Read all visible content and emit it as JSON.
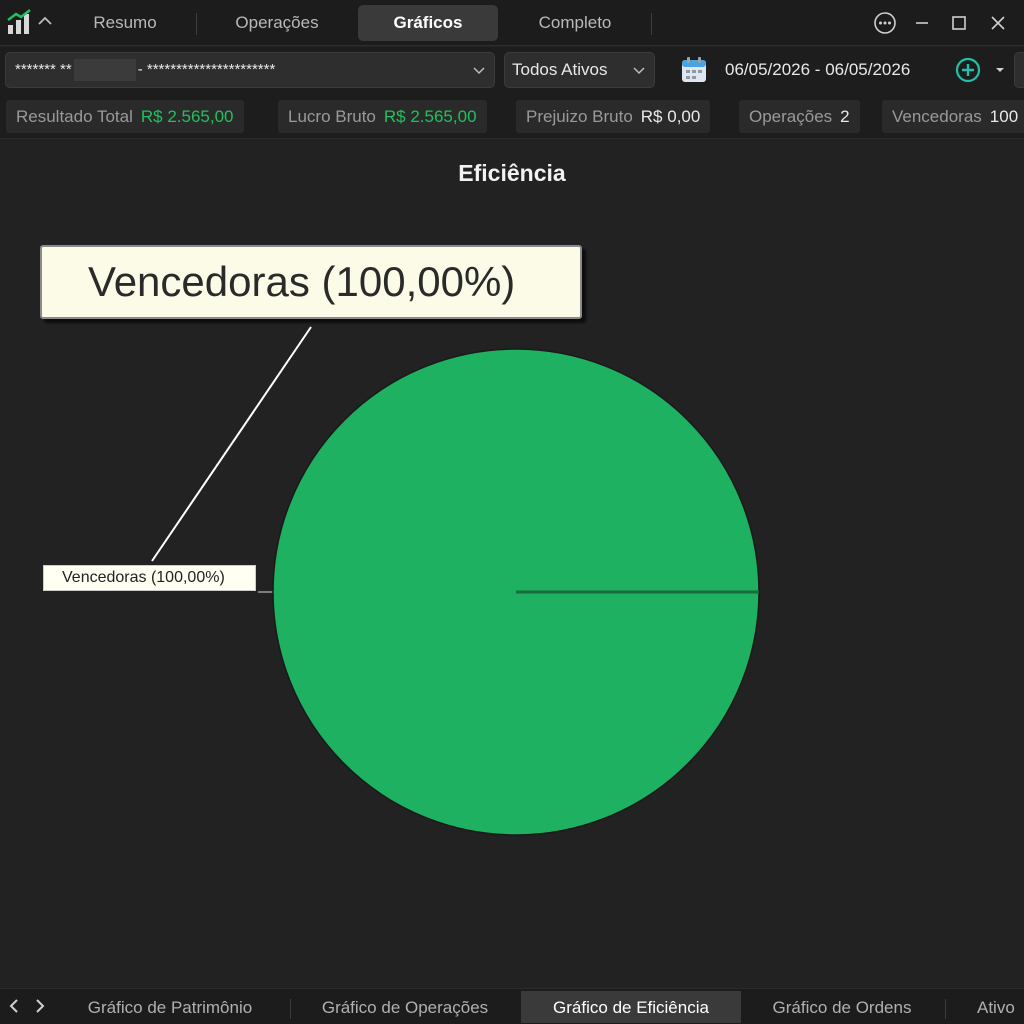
{
  "top_tabs": [
    {
      "label": "Resumo",
      "active": false
    },
    {
      "label": "Operações",
      "active": false
    },
    {
      "label": "Gráficos",
      "active": true
    },
    {
      "label": "Completo",
      "active": false
    }
  ],
  "window_controls": [
    "more-icon",
    "minimize-icon",
    "maximize-icon",
    "close-icon"
  ],
  "filters": {
    "account_prefix": "*******  **",
    "account_suffix": "- **********************",
    "asset_select": "Todos Ativos",
    "date_range": "06/05/2026 - 06/05/2026"
  },
  "stats": [
    {
      "label": "Resultado Total",
      "value": "R$ 2.565,00",
      "color": "#20c15e"
    },
    {
      "label": "Lucro Bruto",
      "value": "R$ 2.565,00",
      "color": "#20c15e"
    },
    {
      "label": "Prejuizo Bruto",
      "value": "R$ 0,00",
      "color": "#e8e8e8"
    },
    {
      "label": "Operações",
      "value": "2",
      "color": "#e8e8e8"
    },
    {
      "label": "Vencedoras",
      "value": "100",
      "color": "#e8e8e8"
    }
  ],
  "chart_data": {
    "type": "pie",
    "title": "Eficiência",
    "slices": [
      {
        "label": "Vencedoras",
        "percent": 100.0,
        "color": "#1fb162"
      }
    ],
    "data_label": "Vencedoras (100,00%)",
    "tooltip": "Vencedoras (100,00%)"
  },
  "bottom_tabs": [
    {
      "label": "Gráfico de Patrimônio",
      "active": false
    },
    {
      "label": "Gráfico de Operações",
      "active": false
    },
    {
      "label": "Gráfico de Eficiência",
      "active": true
    },
    {
      "label": "Gráfico de Ordens",
      "active": false
    },
    {
      "label": "Ativo",
      "active": false
    }
  ],
  "colors": {
    "background": "#232323",
    "accent_green": "#20c15e",
    "pie_green": "#1fb162",
    "tab_active": "#3a3a3a"
  }
}
